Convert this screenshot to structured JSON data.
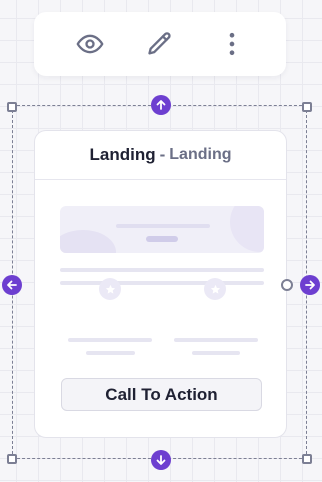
{
  "toolbar": {
    "buttons": [
      {
        "icon": "eye-icon",
        "action": "preview"
      },
      {
        "icon": "pencil-icon",
        "action": "edit"
      },
      {
        "icon": "more-vertical-icon",
        "action": "more"
      }
    ]
  },
  "card": {
    "title": "Landing",
    "separator": "-",
    "subtitle": "Landing",
    "cta_label": "Call To Action"
  },
  "colors": {
    "accent": "#6d3fd0",
    "frame": "#7c7f94",
    "icon": "#6b6f86",
    "canvas": "#f6f6f9"
  }
}
